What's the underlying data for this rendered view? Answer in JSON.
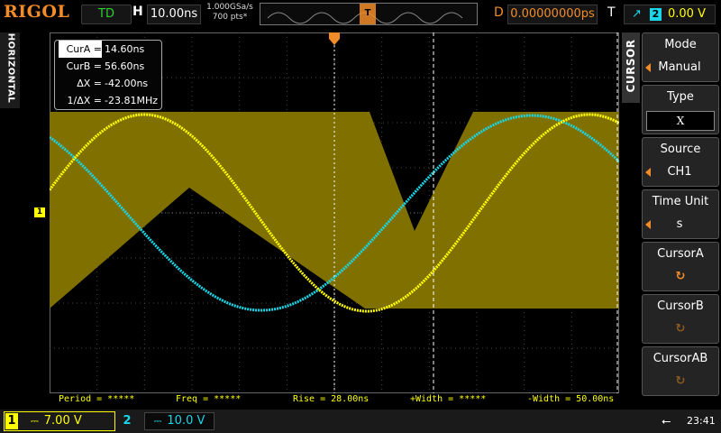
{
  "brand": "RIGOL",
  "topbar": {
    "trigger_status": "TD",
    "h_label": "H",
    "timebase": "10.00ns",
    "sample_rate": "1.000GSa/s",
    "memory_depth": "700 pts*",
    "trigger_position_marker": "T",
    "d_label": "D",
    "delay": "0.00000000ps",
    "t_label": "T",
    "trigger_source": "2",
    "trigger_level": "0.00 V"
  },
  "left_tab": {
    "label": "HORIZONTAL"
  },
  "ch1_marker": "1",
  "cursor_readout": {
    "rows": [
      {
        "label": "CurA =",
        "value": "14.60ns"
      },
      {
        "label": "CurB =",
        "value": "56.60ns"
      },
      {
        "label": "ΔX =",
        "value": "-42.00ns"
      },
      {
        "label": "1/ΔX =",
        "value": "-23.81MHz"
      }
    ]
  },
  "measurements": [
    {
      "text": "Period = *****"
    },
    {
      "text": "Freq = *****"
    },
    {
      "text": "Rise = 28.00ns"
    },
    {
      "text": "+Width = *****"
    },
    {
      "text": "-Width = 50.00ns"
    }
  ],
  "cursor_menu": {
    "tab_label": "CURSOR",
    "items": [
      {
        "title": "Mode",
        "value": "Manual"
      },
      {
        "title": "Type",
        "value": "X"
      },
      {
        "title": "Source",
        "value": "CH1"
      },
      {
        "title": "Time Unit",
        "value": "s"
      },
      {
        "title": "CursorA",
        "knob": "↻"
      },
      {
        "title": "CursorB",
        "knob": "↻"
      },
      {
        "title": "CursorAB",
        "knob": "↻"
      }
    ]
  },
  "channels": [
    {
      "num": "1",
      "scale": "7.00 V"
    },
    {
      "num": "2",
      "scale": "10.0 V"
    }
  ],
  "status": {
    "clock": "23:41",
    "usb_icon": "usb-icon"
  },
  "colors": {
    "ch1": "#ffff00",
    "ch2": "#19d7e8",
    "fill": "#807000",
    "accent": "#f28c28",
    "trigger_status": "#2ed12e"
  }
}
